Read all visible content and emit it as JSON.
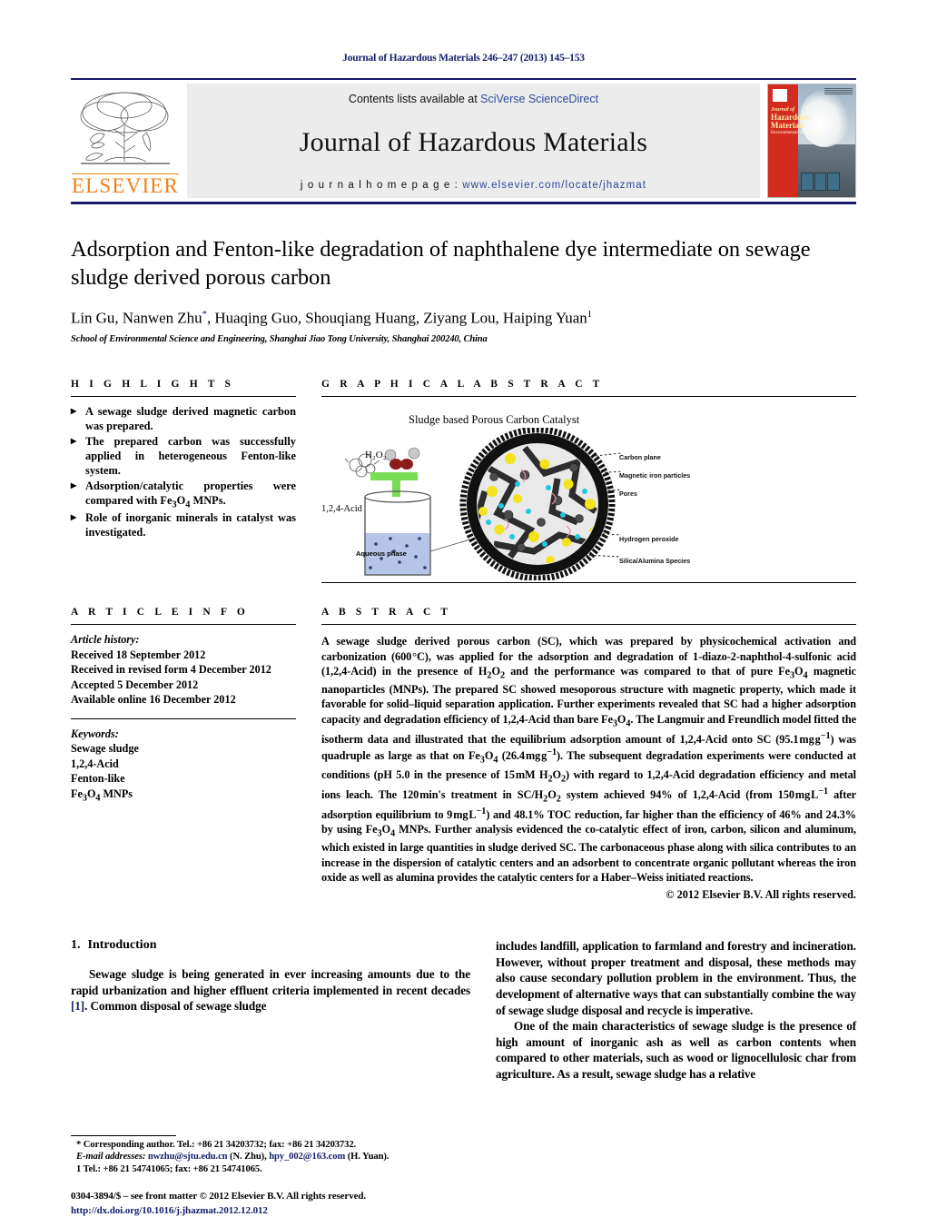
{
  "running_head": "Journal of Hazardous Materials 246–247 (2013) 145–153",
  "masthead": {
    "publisher": "ELSEVIER",
    "contents_prefix": "Contents lists available at ",
    "contents_link": "SciVerse ScienceDirect",
    "journal_title": "Journal of Hazardous Materials",
    "homepage_prefix": "j o u r n a l   h o m e p a g e :  ",
    "homepage_url": "www.elsevier.com/locate/jhazmat",
    "cover_title": "Journal of",
    "cover_title_2": "Hazardous",
    "cover_title_3": "Materials",
    "cover_subtitle": "Environmental Technologies"
  },
  "article": {
    "title": "Adsorption and Fenton-like degradation of naphthalene dye intermediate on sewage sludge derived porous carbon",
    "authors_pre": "Lin Gu, Nanwen Zhu",
    "authors_star": "*",
    "authors_post": ", Huaqing Guo, Shouqiang Huang, Ziyang Lou, Haiping Yuan",
    "authors_sup": "1",
    "affiliation": "School of Environmental Science and Engineering, Shanghai Jiao Tong University, Shanghai 200240, China"
  },
  "highlights": {
    "heading": "H I G H L I G H T S",
    "items": [
      "A sewage sludge derived magnetic carbon was prepared.",
      "The prepared carbon was successfully applied in heterogeneous Fenton-like system.",
      "Adsorption/catalytic properties were compared with Fe3O4 MNPs.",
      "Role of inorganic minerals in catalyst was investigated."
    ]
  },
  "graphical_abstract": {
    "heading": "G R A P H I C A L   A B S T R A C T",
    "figure_caption": "Sludge based Porous Carbon Catalyst",
    "label_h2o2": "H₂O₂",
    "label_acid": "1,2,4-Acid",
    "label_aqueous": "Aqueous phase",
    "legend": [
      "Carbon plane",
      "Magnetic iron particles",
      "Pores",
      "Hydrogen peroxide",
      "Silica/Alumina Species"
    ]
  },
  "article_info": {
    "heading": "A R T I C L E   I N F O",
    "history_label": "Article history:",
    "history": [
      "Received 18 September 2012",
      "Received in revised form 4 December 2012",
      "Accepted 5 December 2012",
      "Available online 16 December 2012"
    ],
    "keywords_label": "Keywords:",
    "keywords": [
      "Sewage sludge",
      "1,2,4-Acid",
      "Fenton-like",
      "Fe3O4 MNPs"
    ]
  },
  "abstract": {
    "heading": "A B S T R A C T",
    "text": "A sewage sludge derived porous carbon (SC), which was prepared by physicochemical activation and carbonization (600 °C), was applied for the adsorption and degradation of 1-diazo-2-naphthol-4-sulfonic acid (1,2,4-Acid) in the presence of H2O2 and the performance was compared to that of pure Fe3O4 magnetic nanoparticles (MNPs). The prepared SC showed mesoporous structure with magnetic property, which made it favorable for solid–liquid separation application. Further experiments revealed that SC had a higher adsorption capacity and degradation efficiency of 1,2,4-Acid than bare Fe3O4. The Langmuir and Freundlich model fitted the isotherm data and illustrated that the equilibrium adsorption amount of 1,2,4-Acid onto SC (95.1 mg g−1) was quadruple as large as that on Fe3O4 (26.4 mg g−1). The subsequent degradation experiments were conducted at conditions (pH 5.0 in the presence of 15 mM H2O2) with regard to 1,2,4-Acid degradation efficiency and metal ions leach. The 120 min's treatment in SC/H2O2 system achieved 94% of 1,2,4-Acid (from 150 mg L−1 after adsorption equilibrium to 9 mg L−1) and 48.1% TOC reduction, far higher than the efficiency of 46% and 24.3% by using Fe3O4 MNPs. Further analysis evidenced the co-catalytic effect of iron, carbon, silicon and aluminum, which existed in large quantities in sludge derived SC. The carbonaceous phase along with silica contributes to an increase in the dispersion of catalytic centers and an adsorbent to concentrate organic pollutant whereas the iron oxide as well as alumina provides the catalytic centers for a Haber–Weiss initiated reactions.",
    "copyright": "© 2012 Elsevier B.V. All rights reserved."
  },
  "introduction": {
    "section_number": "1.",
    "section_title": "Introduction",
    "para_left_1": "Sewage sludge is being generated in ever increasing amounts due to the rapid urbanization and higher effluent criteria implemented in recent decades ",
    "ref_1": "[1]",
    "para_left_1_tail": ". Common disposal of sewage sludge",
    "para_right_1": "includes landfill, application to farmland and forestry and incineration. However, without proper treatment and disposal, these methods may also cause secondary pollution problem in the environment. Thus, the development of alternative ways that can substantially combine the way of sewage sludge disposal and recycle is imperative.",
    "para_right_2": "One of the main characteristics of sewage sludge is the presence of high amount of inorganic ash as well as carbon contents when compared to other materials, such as wood or lignocellulosic char from agriculture. As a result, sewage sludge has a relative"
  },
  "footnotes": {
    "corresponding": "* Corresponding author. Tel.: +86 21 34203732; fax: +86 21 34203732.",
    "email_label": "E-mail addresses:",
    "email_1": "nwzhu@sjtu.edu.cn",
    "email_1_owner": " (N. Zhu),",
    "email_2": "hpy_002@163.com",
    "email_2_owner": " (H. Yuan).",
    "fn1": "1  Tel.: +86 21 54741065; fax: +86 21 54741065."
  },
  "footer": {
    "issn_line": "0304-3894/$ – see front matter © 2012 Elsevier B.V. All rights reserved.",
    "doi_line": "http://dx.doi.org/10.1016/j.jhazmat.2012.12.012"
  },
  "colors": {
    "link": "#16216b",
    "elsevier_orange": "#F07F13",
    "band_gray": "#ececec",
    "rule_navy": "#1a1a6b"
  }
}
